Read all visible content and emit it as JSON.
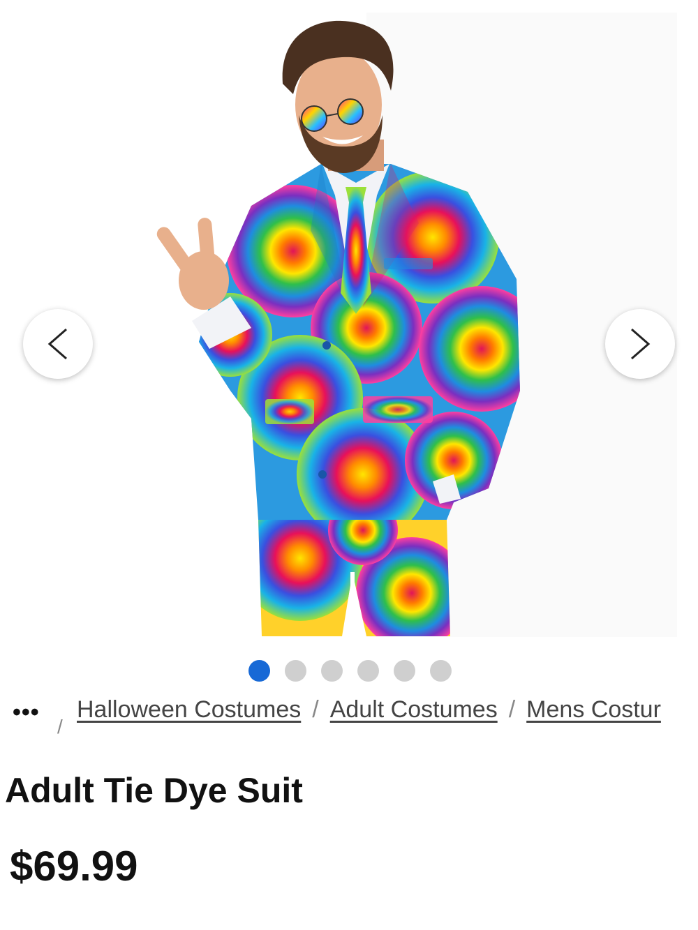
{
  "product": {
    "title": "Adult Tie Dye Suit",
    "price": "$69.99",
    "image_alt": "Man wearing a rainbow tie dye suit with round rainbow sunglasses making a peace sign"
  },
  "carousel": {
    "total_images": 6,
    "active_index": 0,
    "prev_icon": "chevron-left-icon",
    "next_icon": "chevron-right-icon",
    "active_color": "#1769d6",
    "inactive_color": "#cfcfcf"
  },
  "breadcrumb": {
    "more_label": "•••",
    "separator": "/",
    "items": [
      {
        "label": "Halloween Costumes"
      },
      {
        "label": "Adult Costumes"
      },
      {
        "label": "Mens Costur"
      }
    ]
  }
}
